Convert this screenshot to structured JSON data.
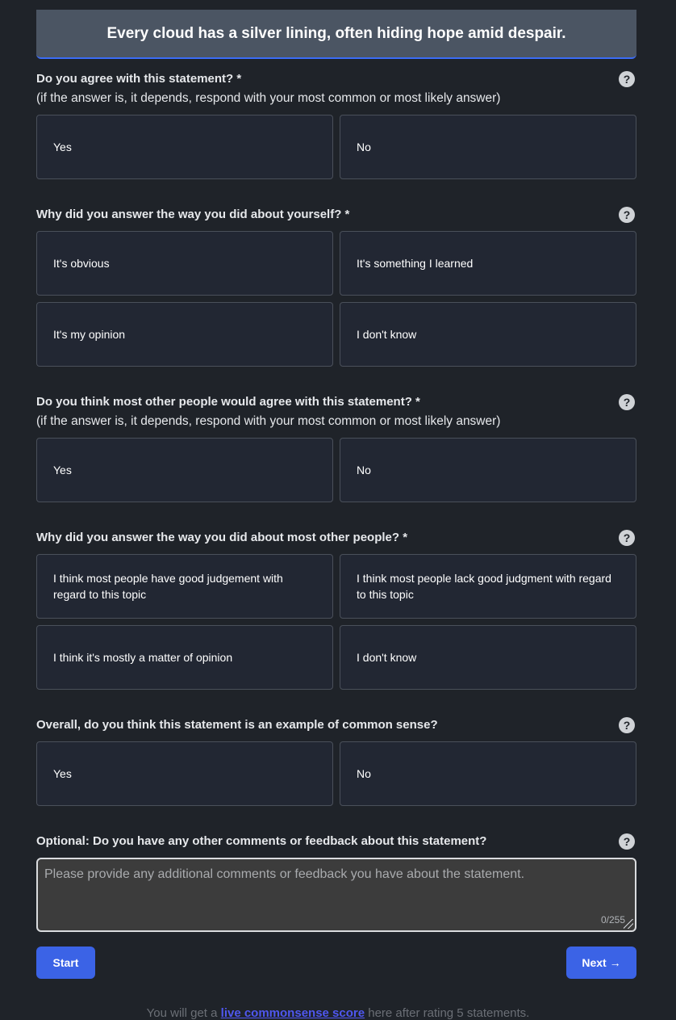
{
  "statement": "Every cloud has a silver lining, often hiding hope amid despair.",
  "help_glyph": "?",
  "questions": [
    {
      "title": "Do you agree with this statement? *",
      "subtitle": "(if the answer is, it depends, respond with your most common or most likely answer)",
      "options": [
        "Yes",
        "No"
      ]
    },
    {
      "title": "Why did you answer the way you did about yourself? *",
      "options": [
        "It's obvious",
        "It's something I learned",
        "It's my opinion",
        "I don't know"
      ]
    },
    {
      "title": "Do you think most other people would agree with this statement? *",
      "subtitle": "(if the answer is, it depends, respond with your most common or most likely answer)",
      "options": [
        "Yes",
        "No"
      ]
    },
    {
      "title": "Why did you answer the way you did about most other people? *",
      "options": [
        "I think most people have good judgement with regard to this topic",
        "I think most people lack good judgment with regard to this topic",
        "I think it's mostly a matter of opinion",
        "I don't know"
      ]
    },
    {
      "title": "Overall, do you think this statement is an example of common sense?",
      "options": [
        "Yes",
        "No"
      ]
    }
  ],
  "comments": {
    "label_prefix": "Optional:",
    "label": "Do you have any other comments or feedback about this statement?",
    "placeholder": "Please provide any additional comments or feedback you have about the statement.",
    "value": "",
    "counter": "0/255"
  },
  "buttons": {
    "start": "Start",
    "next": "Next →"
  },
  "footer": {
    "before": "You will get a ",
    "link": "live commonsense score",
    "after": " here after rating 5 statements."
  },
  "colors": {
    "background": "#1f2329",
    "card": "#222733",
    "accent": "#3b63e6",
    "link": "#4f57f0"
  }
}
